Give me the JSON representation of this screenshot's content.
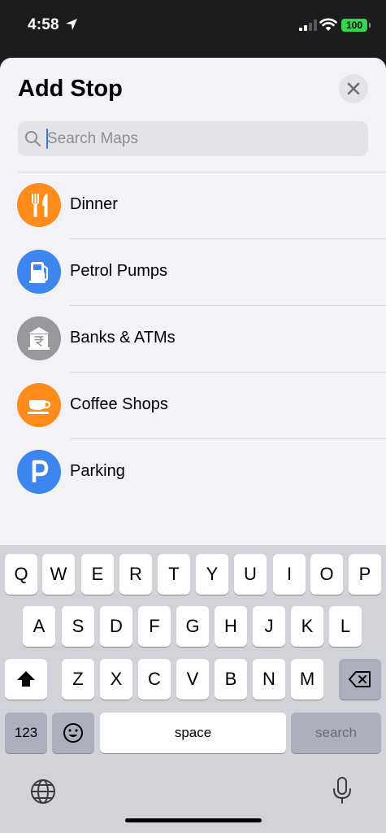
{
  "status_bar": {
    "time": "4:58",
    "battery": "100"
  },
  "sheet": {
    "title": "Add Stop",
    "search": {
      "value": "",
      "placeholder": "Search Maps"
    },
    "categories": [
      {
        "label": "Dinner",
        "icon": "fork-knife-icon",
        "color": "#ff8c1a"
      },
      {
        "label": "Petrol Pumps",
        "icon": "fuel-pump-icon",
        "color": "#3d86f0"
      },
      {
        "label": "Banks & ATMs",
        "icon": "bank-rupee-icon",
        "color": "#98989d"
      },
      {
        "label": "Coffee Shops",
        "icon": "coffee-cup-icon",
        "color": "#ff8c1a"
      },
      {
        "label": "Parking",
        "icon": "parking-icon",
        "color": "#3d86f0"
      }
    ]
  },
  "keyboard": {
    "row1": [
      "Q",
      "W",
      "E",
      "R",
      "T",
      "Y",
      "U",
      "I",
      "O",
      "P"
    ],
    "row2": [
      "A",
      "S",
      "D",
      "F",
      "G",
      "H",
      "J",
      "K",
      "L"
    ],
    "row3": [
      "Z",
      "X",
      "C",
      "V",
      "B",
      "N",
      "M"
    ],
    "numbers_label": "123",
    "space_label": "space",
    "search_label": "search"
  }
}
